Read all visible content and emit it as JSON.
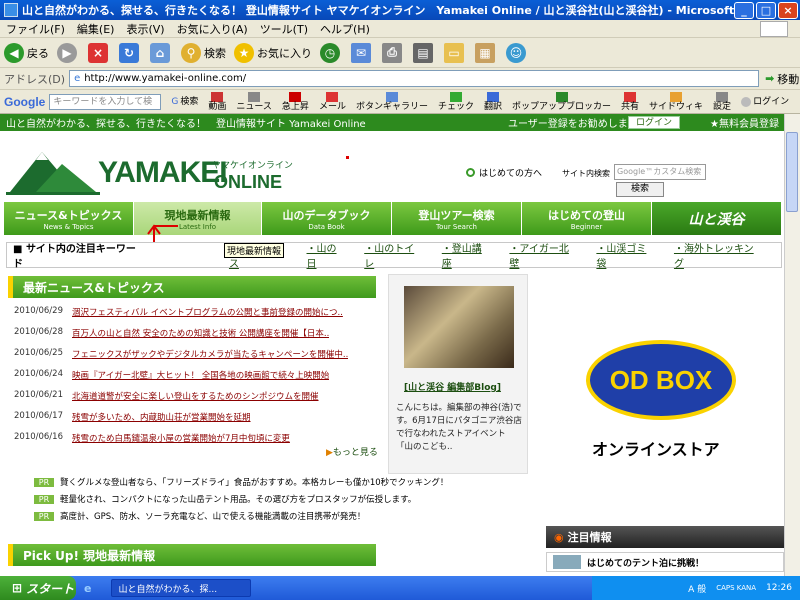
{
  "window": {
    "title": "山と自然がわかる、探せる、行きたくなる！ 登山情報サイト ヤマケイオンライン　Yamakei Online / 山と渓谷社(山と渓谷社) - Microsoft Internet Explorer",
    "minimize": "_",
    "maximize": "□",
    "close": "×"
  },
  "menu": {
    "items": [
      "ファイル(F)",
      "編集(E)",
      "表示(V)",
      "お気に入り(A)",
      "ツール(T)",
      "ヘルプ(H)"
    ]
  },
  "toolbar": {
    "back": "戻る",
    "search": "検索",
    "favorites": "お気に入り"
  },
  "address": {
    "label": "アドレス(D)",
    "url": "http://www.yamakei-online.com/",
    "go": "移動"
  },
  "googlebar": {
    "brand": "Google",
    "placeholder": "キーワードを入力して検",
    "search": "検索",
    "buttons": [
      "動画",
      "ニュース",
      "急上昇",
      "メール",
      "ボタンギャラリー",
      "チェック",
      "翻訳",
      "ポップアップブロッカー",
      "共有",
      "サイドウィキ",
      "設定",
      "ログイン"
    ]
  },
  "site": {
    "topstrip_text": "山と自然がわかる、探せる、行きたくなる！　登山情報サイト Yamakei Online",
    "register_text": "ユーザー登録をお勧めします",
    "login": "ログイン",
    "free_member": "★無料会員登録",
    "logo_main": "YAMAKEI",
    "logo_online": "ONLINE",
    "logo_kana": "ヤマケイオンライン",
    "first_time": "はじめての方へ",
    "site_search_label": "サイト内検索",
    "gcustom_placeholder": "Google™カスタム検索",
    "search_button": "検索",
    "nav": [
      {
        "jp": "ニュース&トピックス",
        "en": "News & Topics"
      },
      {
        "jp": "現地最新情報",
        "en": "Latest Info"
      },
      {
        "jp": "山のデータブック",
        "en": "Data Book"
      },
      {
        "jp": "登山ツアー検索",
        "en": "Tour Search"
      },
      {
        "jp": "はじめての登山",
        "en": "Beginner"
      },
      {
        "jp": "山と渓谷",
        "en": ""
      }
    ],
    "keywords_label": "サイト内の注目キーワード",
    "keywords": [
      "・涸沢フェス",
      "・山の日",
      "・山のトイレ",
      "・登山講座",
      "・アイガー北壁",
      "・山渓ゴミ袋",
      "・海外トレッキング"
    ],
    "tooltip": "現地最新情報",
    "news_heading": "最新ニュース&トピックス",
    "news": [
      {
        "date": "2010/06/29",
        "text": "涸沢フェスティバル イベントプログラムの公開と事前登録の開始につ.."
      },
      {
        "date": "2010/06/28",
        "text": "百万人の山と自然 安全のための知識と技術 公開講座を開催【日本.."
      },
      {
        "date": "2010/06/25",
        "text": "フェニックスがザックやデジタルカメラが当たるキャンペーンを開催中.."
      },
      {
        "date": "2010/06/24",
        "text": "映画『アイガー北壁』大ヒット！ 全国各地の映画館で続々上映開始"
      },
      {
        "date": "2010/06/21",
        "text": "北海道道警が安全に楽しい登山をするためのシンポジウムを開催"
      },
      {
        "date": "2010/06/17",
        "text": "残雪が多いため、内蔵助山荘が営業開始を延期"
      },
      {
        "date": "2010/06/16",
        "text": "残雪のため白馬鑓温泉小屋の営業開始が7月中旬頃に変更"
      }
    ],
    "more": "もっと見る",
    "blog_title": "[山と渓谷 編集部Blog]",
    "blog_text": "こんにちは。編集部の神谷(浩)です。6月17日にパタゴニア渋谷店で行なわれたストアイベント「山のこども..",
    "odbox_logo": "OD BOX",
    "odbox_caption": "オンラインストア",
    "pr_tag": "PR",
    "pr_items": [
      "賢くグルメな登山者なら、「フリーズドライ」食品がおすすめ。本格カレーも僅か10秒でクッキング！",
      "軽量化され、コンパクトになった山岳テント用品。その選び方をプロスタッフが伝授します。",
      "高度計、GPS、防水、ソーラ充電など、山で使える機能満載の注目携帯が発売！"
    ],
    "pickup_heading": "Pick Up! 現地最新情報",
    "attention_heading": "注目情報",
    "attention_item": "はじめてのテント泊に挑戦！"
  },
  "taskbar": {
    "start": "スタート",
    "task": "山と自然がわかる、探...",
    "ime": "A 般",
    "caps": "CAPS KANA",
    "clock": "12:26"
  },
  "colors": {
    "brand_green": "#2d8a1e",
    "news_title_red": "#8b0000",
    "odbox_blue": "#1f3fa8",
    "odbox_yellow": "#fad200"
  }
}
